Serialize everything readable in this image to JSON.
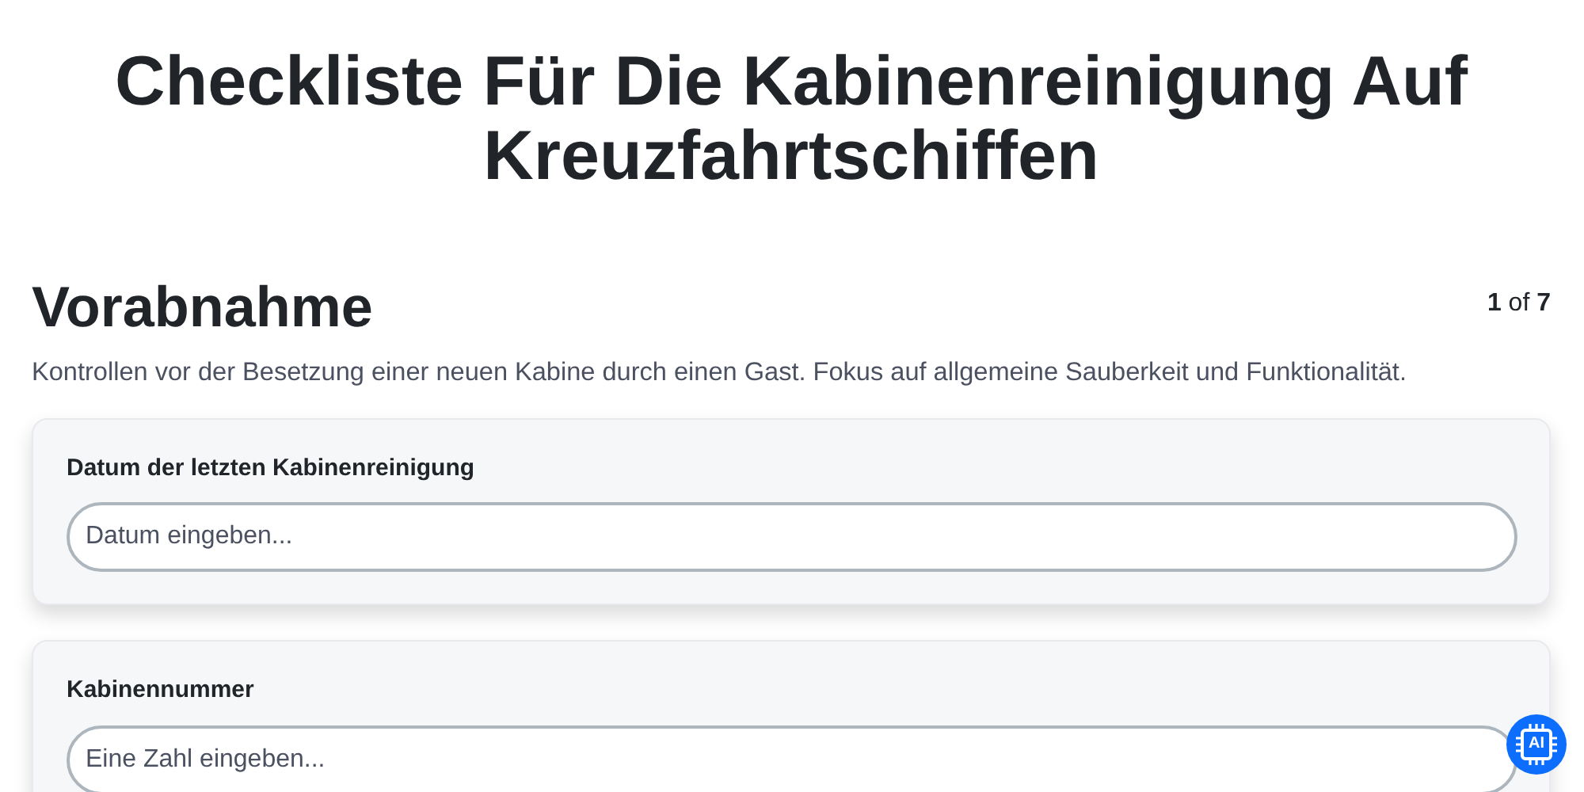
{
  "title": "Checkliste Für Die Kabinenreinigung Auf Kreuzfahrtschiffen",
  "section": {
    "heading": "Vorabnahme",
    "page_indicator": "**1** of **7**",
    "description": "Kontrollen vor der Besetzung einer neuen Kabine durch einen Gast. Fokus auf allgemeine Sauberkeit und Funktionalität."
  },
  "questions": [
    {
      "label": "Datum der letzten Kabinenreinigung",
      "placeholder": "Datum eingeben..."
    },
    {
      "label": "Kabinennummer",
      "placeholder": "Eine Zahl eingeben..."
    }
  ],
  "assistant_button": {
    "label": "AI"
  }
}
